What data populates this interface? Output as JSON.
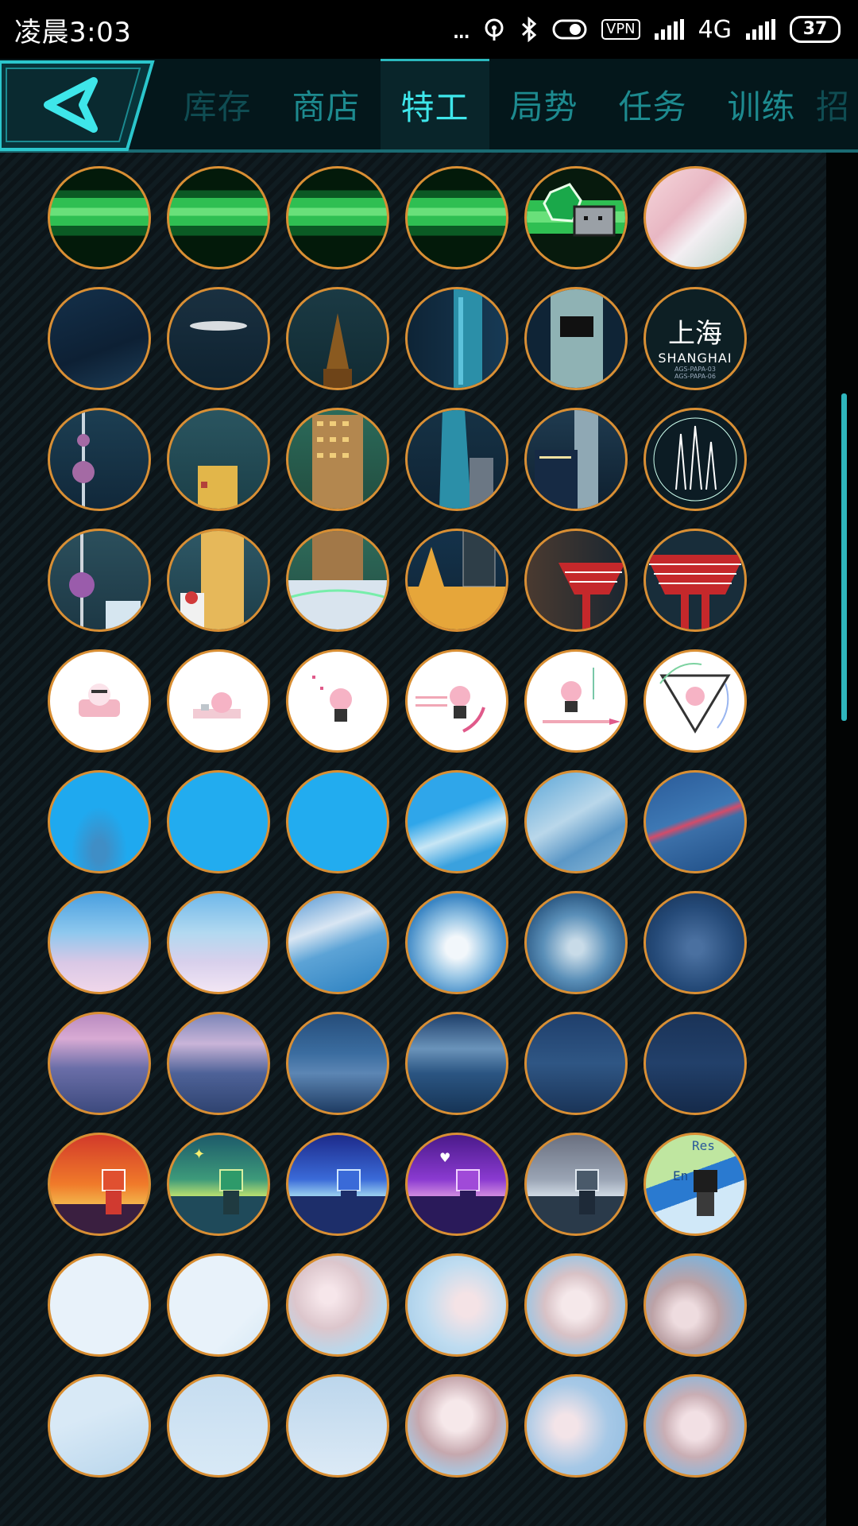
{
  "status_bar": {
    "time": "凌晨3:03",
    "dots": "...",
    "vpn": "VPN",
    "network": "4G",
    "battery": "37"
  },
  "nav": {
    "back_icon": "triangle-left-icon",
    "tabs": [
      {
        "label": "库存",
        "state": "dim"
      },
      {
        "label": "商店",
        "state": "normal"
      },
      {
        "label": "特工",
        "state": "active"
      },
      {
        "label": "局势",
        "state": "normal"
      },
      {
        "label": "任务",
        "state": "normal"
      },
      {
        "label": "训练",
        "state": "normal"
      },
      {
        "label": "招",
        "state": "clip"
      }
    ]
  },
  "shanghai_badge": {
    "title": "上海",
    "subtitle": "SHANGHAI",
    "code1": "AGS-PAPA-03",
    "code2": "AGS-PAPA-06"
  },
  "pixel_label": {
    "text": "Res",
    "text2": "En"
  },
  "colors": {
    "accent": "#3ee6ea",
    "border": "#d98f34",
    "tab_text": "#1d8a8f"
  }
}
